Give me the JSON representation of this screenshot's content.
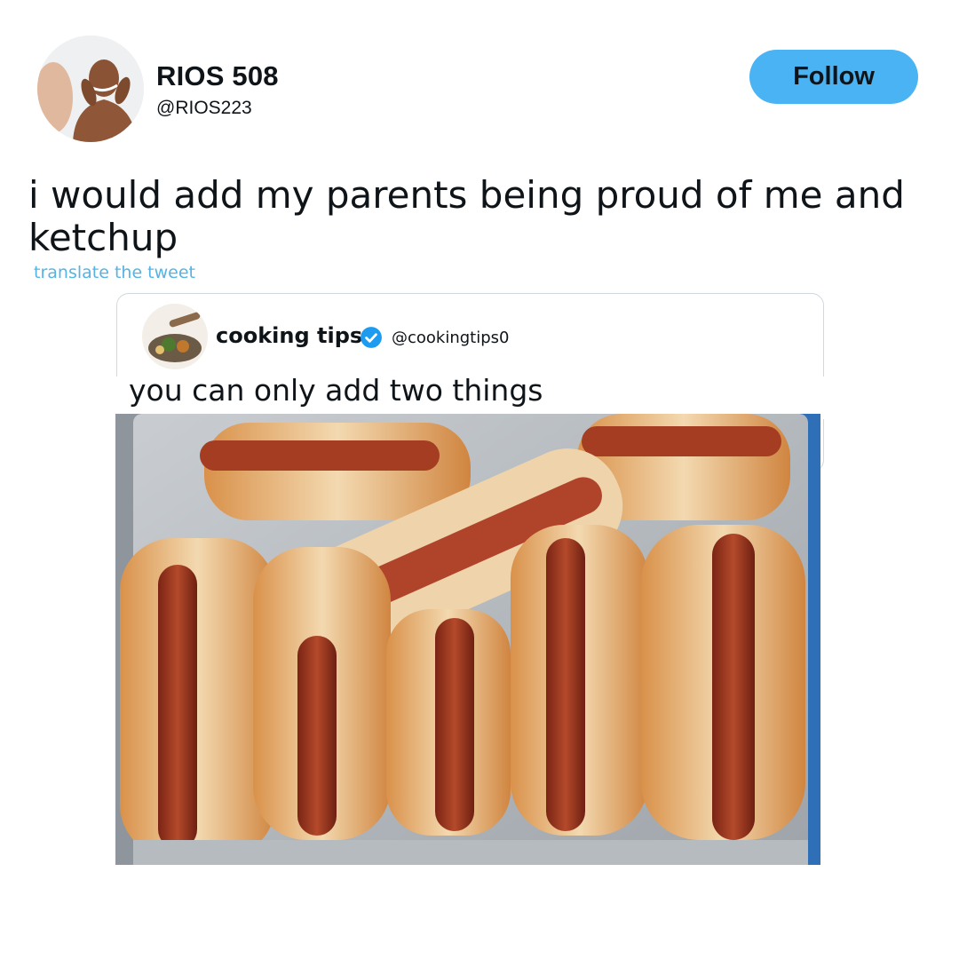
{
  "tweet": {
    "author_name": "RIOS 508",
    "author_handle": "@RIOS223",
    "follow_label": "Follow",
    "text": "i would add my parents being proud of me and ketchup",
    "translate_link": "translate the tweet"
  },
  "quoted_tweet": {
    "author_name": "cooking tips",
    "author_handle": "@cookingtips0",
    "verified": true,
    "text": "you can only add two things",
    "image_subject": "tray of hot dogs in buns"
  },
  "colors": {
    "follow_button": "#4ab3f4",
    "link": "#55b4e4",
    "verified_badge": "#1d9bf0",
    "text": "#0f1419"
  },
  "icons": [
    "verified-badge-icon"
  ]
}
